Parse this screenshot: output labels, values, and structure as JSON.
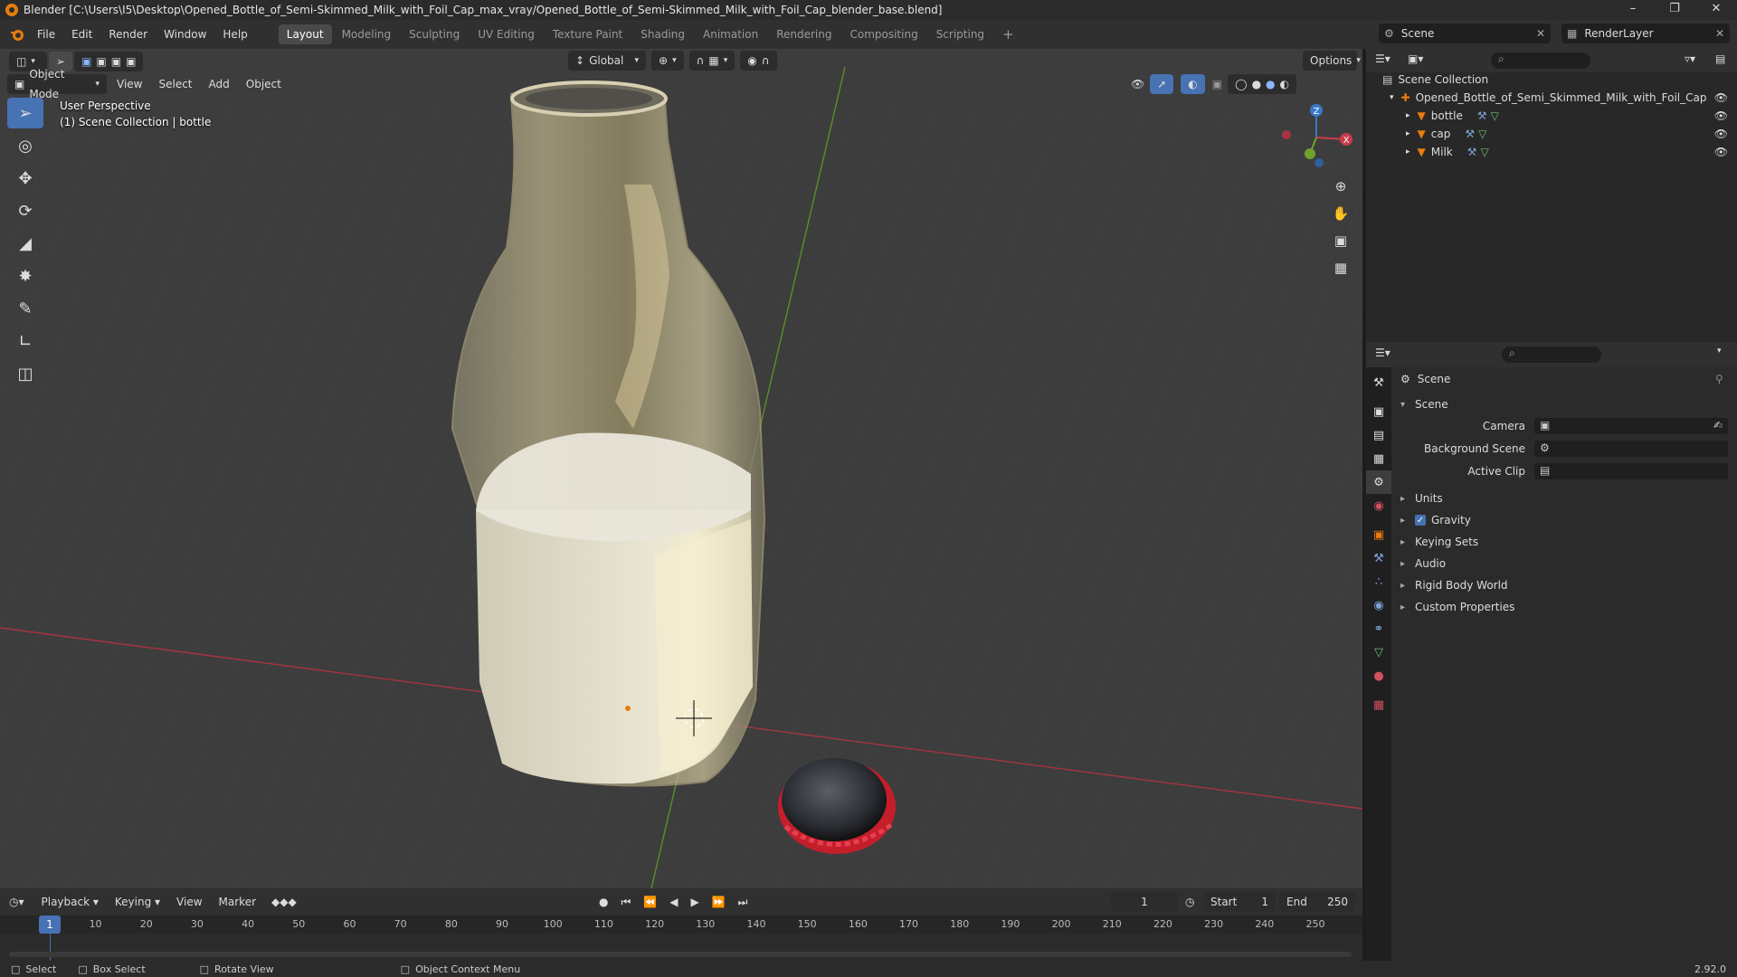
{
  "window": {
    "title": "Blender [C:\\Users\\I5\\Desktop\\Opened_Bottle_of_Semi-Skimmed_Milk_with_Foil_Cap_max_vray/Opened_Bottle_of_Semi-Skimmed_Milk_with_Foil_Cap_blender_base.blend]"
  },
  "menu": [
    "File",
    "Edit",
    "Render",
    "Window",
    "Help"
  ],
  "workspaces": [
    "Layout",
    "Modeling",
    "Sculpting",
    "UV Editing",
    "Texture Paint",
    "Shading",
    "Animation",
    "Rendering",
    "Compositing",
    "Scripting"
  ],
  "topright": {
    "scene": "Scene",
    "render_layer": "RenderLayer"
  },
  "viewport": {
    "mode": "Object Mode",
    "menus": [
      "View",
      "Select",
      "Add",
      "Object"
    ],
    "orientation": "Global",
    "options": "Options",
    "overlay_line1": "User Perspective",
    "overlay_line2": "(1) Scene Collection | bottle",
    "gizmo": {
      "z": "Z",
      "x": "X"
    }
  },
  "timeline": {
    "menus": [
      "Playback",
      "Keying",
      "View",
      "Marker"
    ],
    "current_frame": "1",
    "start_label": "Start",
    "start": "1",
    "end_label": "End",
    "end": "250",
    "ticks": [
      "10",
      "20",
      "30",
      "40",
      "50",
      "60",
      "70",
      "80",
      "90",
      "100",
      "110",
      "120",
      "130",
      "140",
      "150",
      "160",
      "170",
      "180",
      "190",
      "200",
      "210",
      "220",
      "230",
      "240",
      "250"
    ],
    "playhead": "1"
  },
  "outliner": {
    "root": "Scene Collection",
    "collection": "Opened_Bottle_of_Semi_Skimmed_Milk_with_Foil_Cap",
    "objects": [
      "bottle",
      "cap",
      "Milk"
    ]
  },
  "properties": {
    "context": "Scene",
    "panel": "Scene",
    "fields": [
      {
        "label": "Camera"
      },
      {
        "label": "Background Scene"
      },
      {
        "label": "Active Clip"
      }
    ],
    "sections": [
      "Units",
      "Gravity",
      "Keying Sets",
      "Audio",
      "Rigid Body World",
      "Custom Properties"
    ],
    "gravity_checked": true
  },
  "statusbar": {
    "select": "Select",
    "box_select": "Box Select",
    "rotate": "Rotate View",
    "context_menu": "Object Context Menu",
    "version": "2.92.0"
  },
  "colors": {
    "accent": "#4772b3",
    "x_axis": "#c83c4a",
    "y_axis": "#6ea22e",
    "z_axis": "#3b78c6",
    "object_orange": "#e87d0d"
  }
}
